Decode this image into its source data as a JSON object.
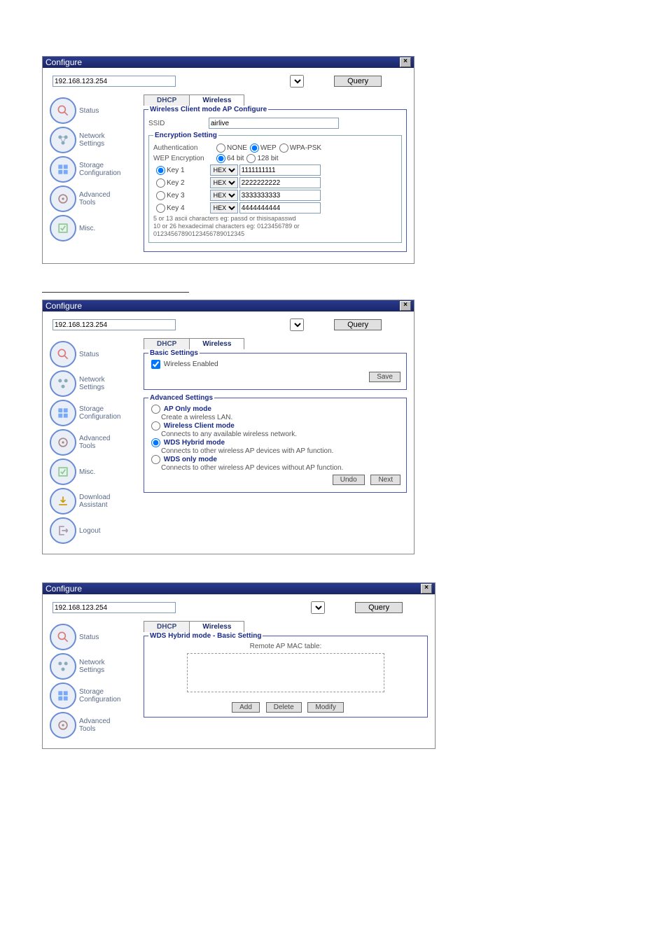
{
  "common": {
    "title": "Configure",
    "ip": "192.168.123.254",
    "query": "Query",
    "tabs": {
      "dhcp": "DHCP",
      "wireless": "Wireless"
    },
    "side": {
      "status": "Status",
      "network": "Network\nSettings",
      "storage": "Storage\nConfiguration",
      "adv": "Advanced\nTools",
      "misc": "Misc.",
      "download": "Download\nAssistant",
      "logout": "Logout"
    }
  },
  "w1": {
    "fs_title": "Wireless Client mode AP Configure",
    "ssid_lab": "SSID",
    "ssid_val": "airlive",
    "enc_title": "Encryption Setting",
    "auth_lab": "Authentication",
    "auth_none": "NONE",
    "auth_wep": "WEP",
    "auth_wpa": "WPA-PSK",
    "wepenc_lab": "WEP Encryption",
    "bit64": "64 bit",
    "bit128": "128 bit",
    "key1": "Key 1",
    "key2": "Key 2",
    "key3": "Key 3",
    "key4": "Key 4",
    "hex": "HEX",
    "kv1": "1111111111",
    "kv2": "2222222222",
    "kv3": "3333333333",
    "kv4": "4444444444",
    "hint": "5 or 13 ascii characters eg: passd or thisisapasswd\n10 or 26 hexadecimal characters eg: 0123456789 or\n01234567890123456789012345"
  },
  "w2": {
    "basic_title": "Basic Settings",
    "enabled": "Wireless Enabled",
    "save": "Save",
    "adv_title": "Advanced Settings",
    "m1": "AP Only mode",
    "m1d": "Create a wireless LAN.",
    "m2": "Wireless Client mode",
    "m2d": "Connects to any available wireless network.",
    "m3": "WDS Hybrid mode",
    "m3d": "Connects to other wireless AP devices with AP function.",
    "m4": "WDS only mode",
    "m4d": "Connects to other wireless AP devices without AP function.",
    "undo": "Undo",
    "next": "Next"
  },
  "w3": {
    "fs_title": "WDS Hybrid mode - Basic Setting",
    "mac_title": "Remote AP MAC table:",
    "add": "Add",
    "del": "Delete",
    "mod": "Modify"
  }
}
